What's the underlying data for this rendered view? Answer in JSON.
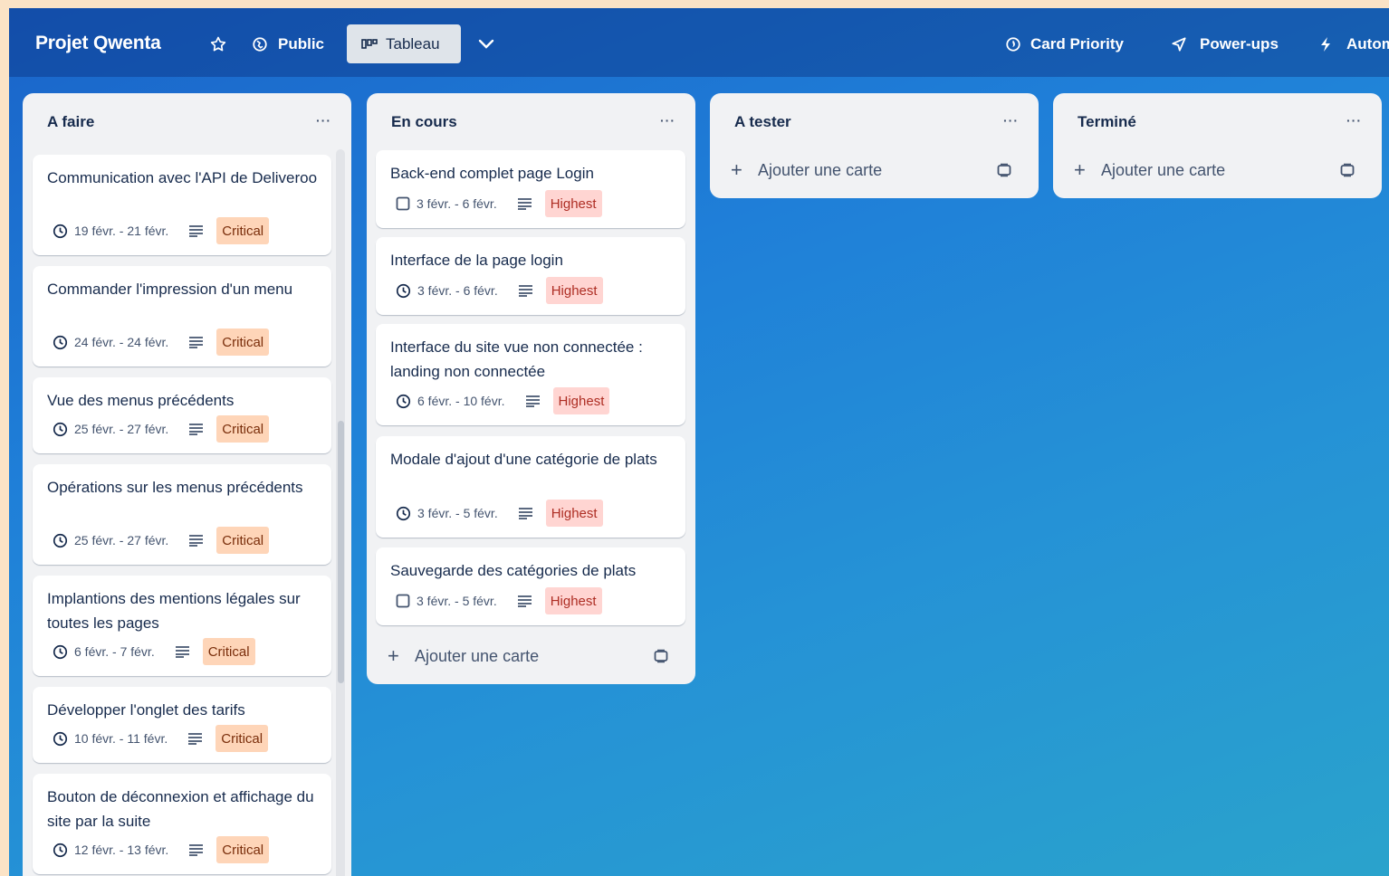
{
  "header": {
    "board_title": "Projet Qwenta",
    "public_label": "Public",
    "view_label": "Tableau",
    "card_priority_label": "Card Priority",
    "powerups_label": "Power-ups",
    "automation_label": "Autom"
  },
  "lists": [
    {
      "title": "A faire",
      "menu": "···",
      "cards": [
        {
          "title": "Communication avec l'API de Deliveroo",
          "date": "19 févr. - 21 févr.",
          "priority": "Critical"
        },
        {
          "title": "Commander l'impression d'un menu",
          "date": "24 févr. - 24 févr.",
          "priority": "Critical"
        },
        {
          "title": "Vue des menus précédents",
          "date": "25 févr. - 27 févr.",
          "priority": "Critical"
        },
        {
          "title": "Opérations sur les menus précédents",
          "date": "25 févr. - 27 févr.",
          "priority": "Critical"
        },
        {
          "title": "Implantions des mentions légales sur toutes les pages",
          "date": "6 févr. - 7 févr.",
          "priority": "Critical"
        },
        {
          "title": "Développer l'onglet des tarifs",
          "date": "10 févr. - 11 févr.",
          "priority": "Critical"
        },
        {
          "title": "Bouton de déconnexion et affichage du site par la suite",
          "date": "12 févr. - 13 févr.",
          "priority": "Critical"
        }
      ]
    },
    {
      "title": "En cours",
      "menu": "···",
      "add_card_label": "Ajouter une carte",
      "cards": [
        {
          "title": "Back-end complet page Login",
          "date": "3 févr. - 6 févr.",
          "priority": "Highest"
        },
        {
          "title": "Interface de la page login",
          "date": "3 févr. - 6 févr.",
          "priority": "Highest"
        },
        {
          "title": "Interface du site vue non connectée : landing non connectée",
          "date": "6 févr. - 10 févr.",
          "priority": "Highest"
        },
        {
          "title": "Modale d'ajout d'une catégorie de plats",
          "date": "3 févr. - 5 févr.",
          "priority": "Highest"
        },
        {
          "title": "Sauvegarde des catégories de plats",
          "date": "3 févr. - 5 févr.",
          "priority": "Highest"
        }
      ]
    },
    {
      "title": "A tester",
      "menu": "···",
      "add_card_label": "Ajouter une carte",
      "cards": []
    },
    {
      "title": "Terminé",
      "menu": "···",
      "add_card_label": "Ajouter une carte",
      "cards": []
    }
  ]
}
